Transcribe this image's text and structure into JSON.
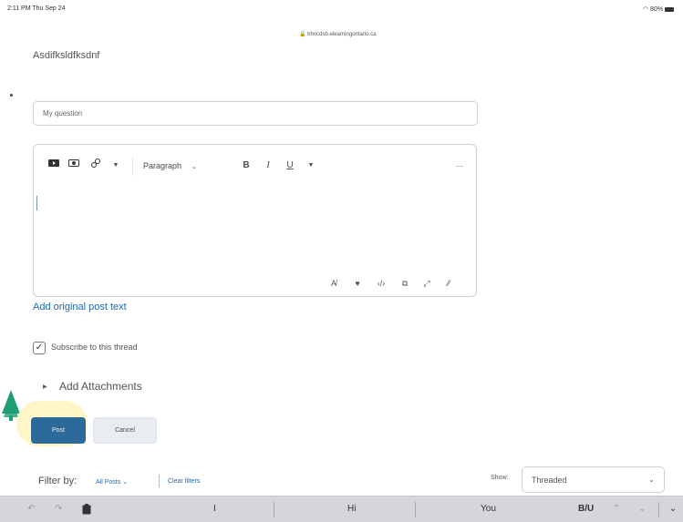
{
  "status_bar": {
    "time": "2:11 PM  Thu Sep 24",
    "url": "bhncdsb.elearningontario.ca",
    "battery": "80%"
  },
  "thread": {
    "title": "Asdifksldfksdnf"
  },
  "subject": {
    "value": "My question"
  },
  "editor": {
    "toolbar": {
      "format_label": "Paragraph",
      "bold": "B",
      "italic": "I",
      "underline": "U",
      "more": "···"
    }
  },
  "add_original_post_text": "Add original post text",
  "subscribe": {
    "label": "Subscribe to this thread",
    "checked": true
  },
  "attachments": {
    "label": "Add Attachments"
  },
  "buttons": {
    "post": "Post",
    "cancel": "Cancel"
  },
  "filter": {
    "label": "Filter by:",
    "value": "All Posts",
    "clear": "Clear filters",
    "show_label": "Show:",
    "show_value": "Threaded"
  },
  "keyboard_bar": {
    "suggestions": [
      "I",
      "Hi",
      "You"
    ],
    "format": "B/U"
  },
  "colors": {
    "accent": "#2b6a9b",
    "link": "#1e67ad",
    "highlight": "#fff6c8",
    "tree": "#1f9d75"
  }
}
